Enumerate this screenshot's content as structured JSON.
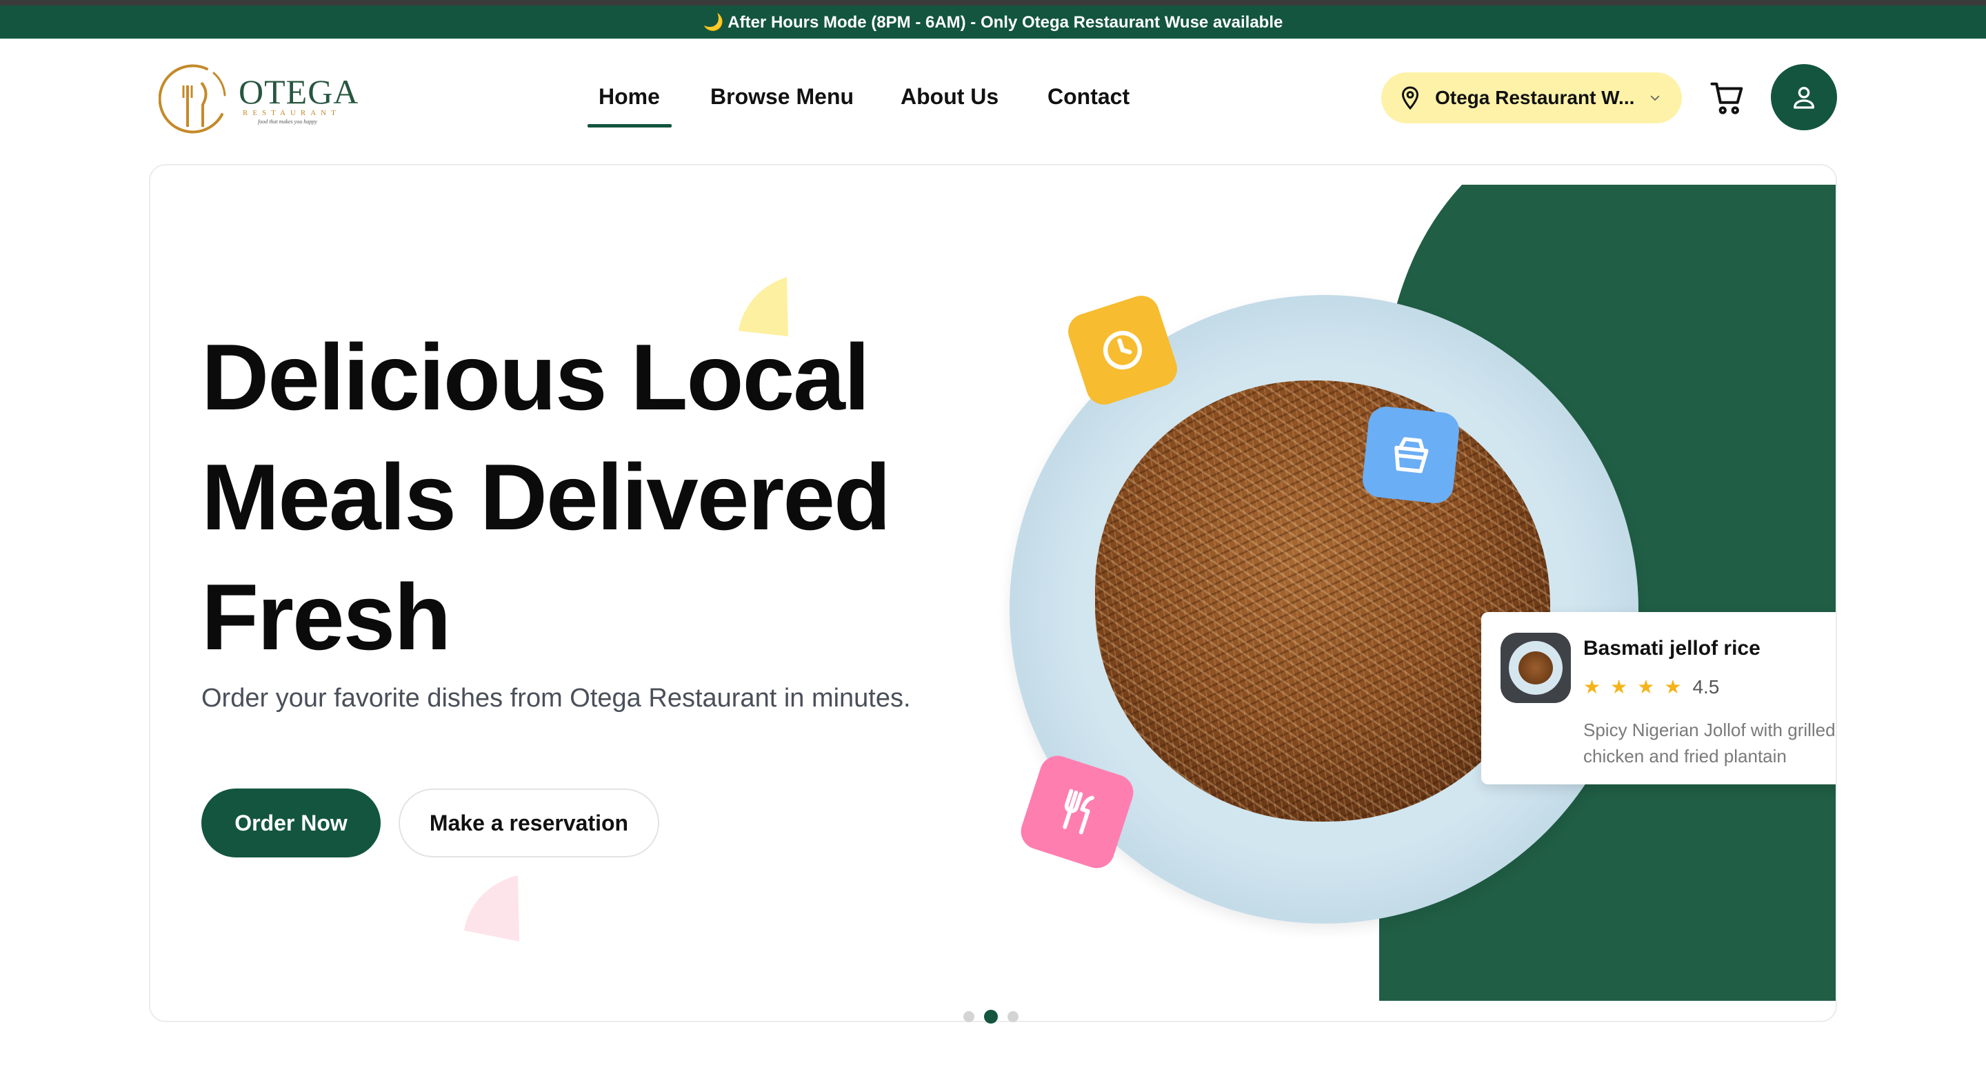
{
  "banner": {
    "text": "🌙 After Hours Mode (8PM - 6AM) - Only Otega Restaurant Wuse available"
  },
  "logo": {
    "name": "OTEGA",
    "sub": "RESTAURANT",
    "tagline": "food that makes you happy"
  },
  "nav": {
    "items": [
      {
        "label": "Home"
      },
      {
        "label": "Browse Menu"
      },
      {
        "label": "About Us"
      },
      {
        "label": "Contact"
      }
    ],
    "active": "Home"
  },
  "location": {
    "label": "Otega Restaurant W...",
    "icon": "map-pin-icon"
  },
  "icons": {
    "cart": "cart-icon",
    "user": "user-icon"
  },
  "hero": {
    "headline": [
      "Delicious Local",
      "Meals Delivered",
      "Fresh"
    ],
    "subtext": "Order your favorite dishes from Otega Restaurant in minutes.",
    "order_button": "Order Now",
    "reserve_button": "Make a reservation"
  },
  "food_card": {
    "name": "Basmati jellof rice",
    "stars": 4,
    "rating": "4.5",
    "description": "Spicy Nigerian Jollof with grilled chicken and fried plantain"
  },
  "carousel": {
    "count": 3,
    "active_index": 1
  },
  "colors": {
    "brand_green": "#13553f",
    "hero_green": "#205e45",
    "pill_yellow": "#fdf2a8",
    "clock_tile": "#f7bc2f",
    "box_tile": "#6aaef5",
    "fork_tile": "#ff7eb0",
    "star": "#f4b41a"
  }
}
